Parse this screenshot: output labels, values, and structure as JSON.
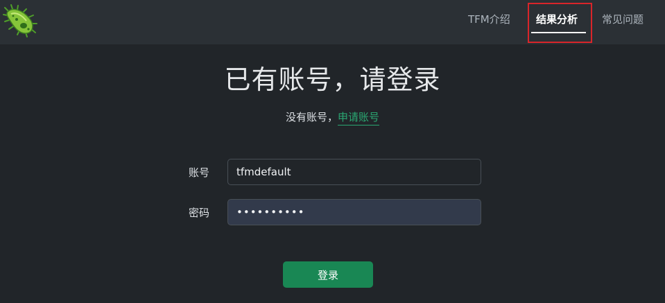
{
  "nav": {
    "items": [
      {
        "label": "TFM介绍"
      },
      {
        "label": "结果分析"
      },
      {
        "label": "常见问题"
      }
    ],
    "active_index": 1
  },
  "login": {
    "title": "已有账号，请登录",
    "no_account_text": "没有账号，",
    "apply_link": "申请账号",
    "account_label": "账号",
    "account_value": "tfmdefault",
    "password_label": "密码",
    "password_value": "tfmdefault",
    "submit_label": "登录"
  },
  "colors": {
    "background": "#212529",
    "navbar": "#2b3035",
    "accent_green": "#198754",
    "link_green": "#2aa772",
    "highlight_red": "#d9252a"
  },
  "icons": {
    "logo": "bacterium-icon"
  }
}
